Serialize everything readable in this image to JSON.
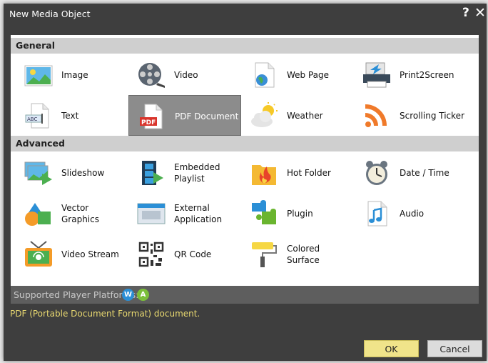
{
  "window": {
    "title": "New Media Object",
    "help_label": "?",
    "close_label": "✕"
  },
  "sections": {
    "general": "General",
    "advanced": "Advanced"
  },
  "items": {
    "image": {
      "label": "Image",
      "icon": "image-icon"
    },
    "video": {
      "label": "Video",
      "icon": "film-reel-icon"
    },
    "web_page": {
      "label": "Web Page",
      "icon": "web-page-icon"
    },
    "print2screen": {
      "label": "Print2Screen",
      "icon": "printer-icon"
    },
    "text": {
      "label": "Text",
      "icon": "text-document-icon"
    },
    "pdf_document": {
      "label": "PDF Document",
      "icon": "pdf-icon"
    },
    "weather": {
      "label": "Weather",
      "icon": "weather-icon"
    },
    "scrolling_ticker": {
      "label": "Scrolling Ticker",
      "icon": "rss-icon"
    },
    "slideshow": {
      "label": "Slideshow",
      "icon": "slideshow-icon"
    },
    "embedded_playlist": {
      "label": "Embedded Playlist",
      "icon": "playlist-icon"
    },
    "hot_folder": {
      "label": "Hot Folder",
      "icon": "hot-folder-icon"
    },
    "date_time": {
      "label": "Date / Time",
      "icon": "alarm-clock-icon"
    },
    "vector_graphics": {
      "label": "Vector Graphics",
      "icon": "shapes-icon"
    },
    "external_application": {
      "label": "External Application",
      "icon": "application-window-icon"
    },
    "plugin": {
      "label": "Plugin",
      "icon": "puzzle-icon"
    },
    "audio": {
      "label": "Audio",
      "icon": "music-note-icon"
    },
    "video_stream": {
      "label": "Video Stream",
      "icon": "tv-antenna-icon"
    },
    "qr_code": {
      "label": "QR Code",
      "icon": "qr-code-icon"
    },
    "colored_surface": {
      "label": "Colored Surface",
      "icon": "paint-roller-icon"
    }
  },
  "selected_item": "pdf_document",
  "platforms": {
    "label": "Supported Player Platforms:",
    "badges": [
      "W",
      "A"
    ],
    "badge_colors": [
      "#2b8fd6",
      "#7bbf3a"
    ]
  },
  "description": "PDF (Portable Document Format) document.",
  "buttons": {
    "ok": "OK",
    "cancel": "Cancel"
  },
  "colors": {
    "dialog_bg": "#3e3e3e",
    "section_header": "#cfcfcf",
    "selected_bg": "#8c8c8c",
    "description_text": "#e8d870",
    "ok_button": "#f0e48a"
  }
}
